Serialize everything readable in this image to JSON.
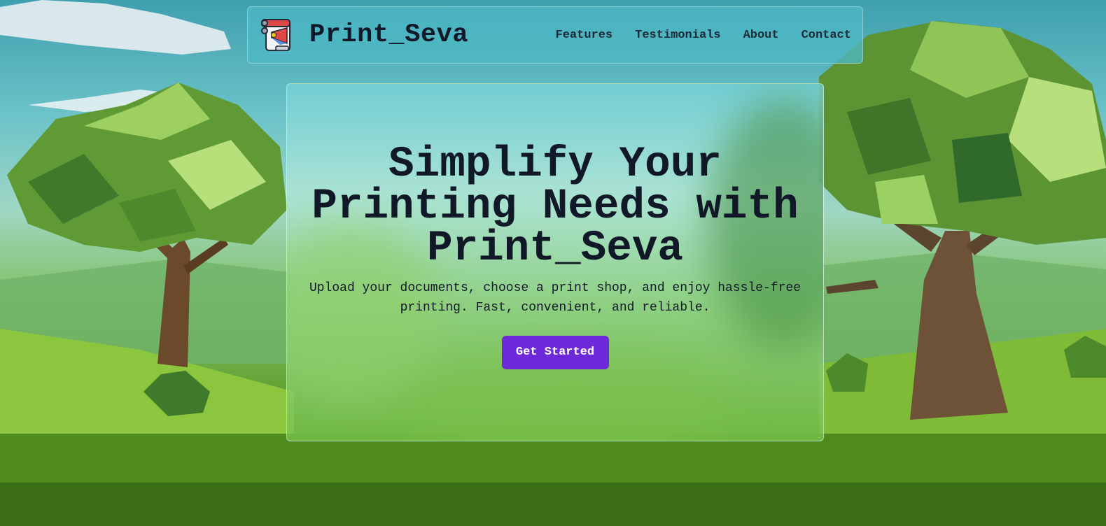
{
  "brand": {
    "name": "Print_Seva",
    "logo_icon": "printer-scroll-icon"
  },
  "nav": {
    "items": [
      {
        "label": "Features"
      },
      {
        "label": "Testimonials"
      },
      {
        "label": "About"
      },
      {
        "label": "Contact"
      }
    ]
  },
  "hero": {
    "title_line1": "Simplify Your",
    "title_line2": "Printing Needs with",
    "title_line3": "Print_Seva",
    "subtitle_line1": "Upload your documents, choose a print shop, and enjoy hassle-free",
    "subtitle_line2": "printing. Fast, convenient, and reliable.",
    "cta_label": "Get Started"
  },
  "colors": {
    "accent": "#6d28d9",
    "text": "#111827",
    "navbar_bg": "#4eb8c4"
  }
}
